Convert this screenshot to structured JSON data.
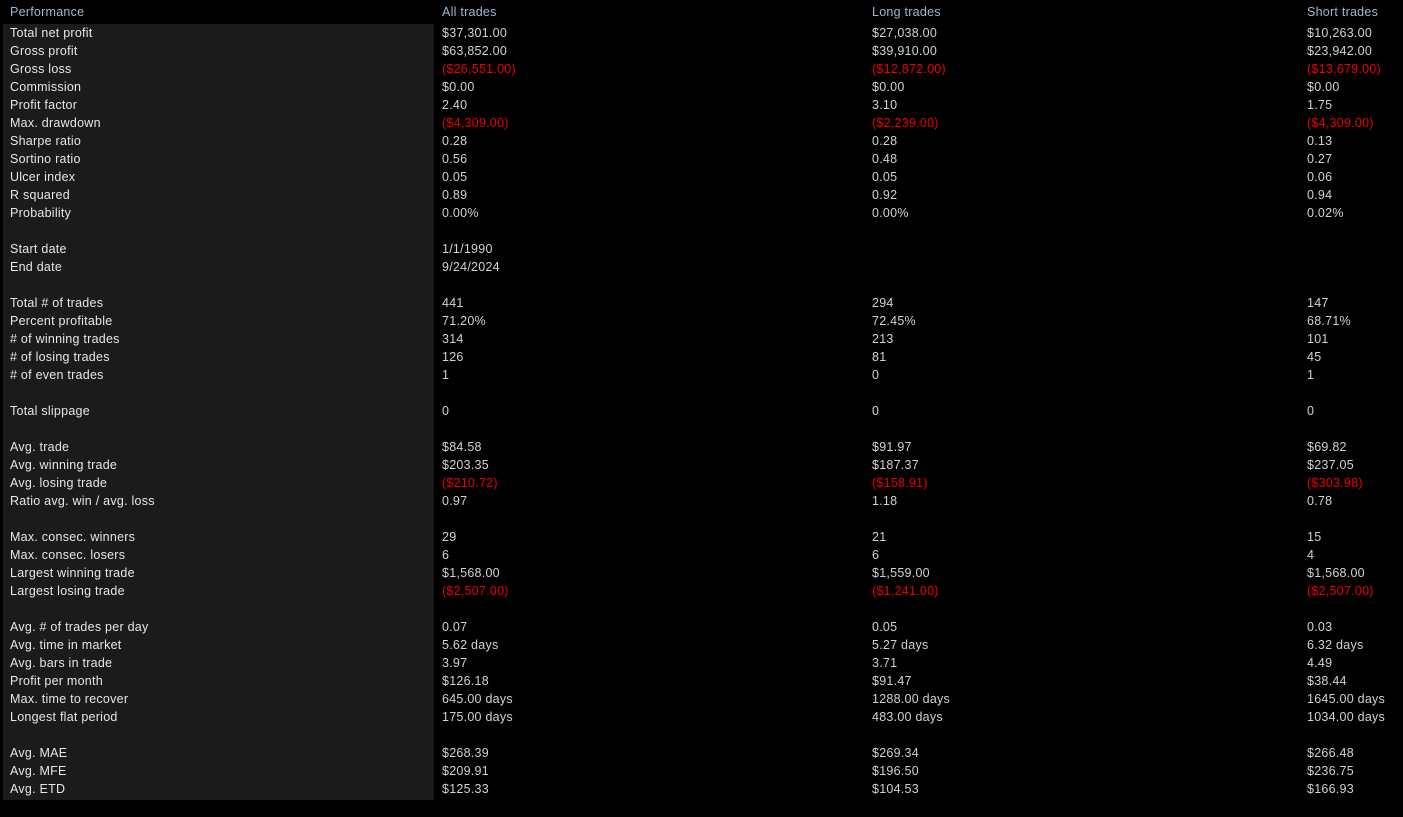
{
  "report": {
    "title": "Performance",
    "columns": [
      "Performance",
      "All trades",
      "Long trades",
      "Short trades"
    ],
    "colors": {
      "background": "#000000",
      "label_panel": "#1b1b1b",
      "header_text": "#9fb8d0",
      "label_text": "#e6e6e6",
      "value_text": "#d2d2d2",
      "negative_value": "#ef0000"
    },
    "rows": [
      {
        "label": "Total net profit",
        "all": "$37,301.00",
        "long": "$27,038.00",
        "short": "$10,263.00",
        "neg": false
      },
      {
        "label": "Gross profit",
        "all": "$63,852.00",
        "long": "$39,910.00",
        "short": "$23,942.00",
        "neg": false
      },
      {
        "label": "Gross loss",
        "all": "($26,551.00)",
        "long": "($12,872.00)",
        "short": "($13,679.00)",
        "neg": true
      },
      {
        "label": "Commission",
        "all": "$0.00",
        "long": "$0.00",
        "short": "$0.00",
        "neg": false
      },
      {
        "label": "Profit factor",
        "all": "2.40",
        "long": "3.10",
        "short": "1.75",
        "neg": false
      },
      {
        "label": "Max. drawdown",
        "all": "($4,309.00)",
        "long": "($2,239.00)",
        "short": "($4,309.00)",
        "neg": true
      },
      {
        "label": "Sharpe ratio",
        "all": "0.28",
        "long": "0.28",
        "short": "0.13",
        "neg": false
      },
      {
        "label": "Sortino ratio",
        "all": "0.56",
        "long": "0.48",
        "short": "0.27",
        "neg": false
      },
      {
        "label": "Ulcer index",
        "all": "0.05",
        "long": "0.05",
        "short": "0.06",
        "neg": false
      },
      {
        "label": "R squared",
        "all": "0.89",
        "long": "0.92",
        "short": "0.94",
        "neg": false
      },
      {
        "label": "Probability",
        "all": "0.00%",
        "long": "0.00%",
        "short": "0.02%",
        "neg": false
      },
      {
        "spacer": true
      },
      {
        "label": "Start date",
        "all": "1/1/1990",
        "long": "",
        "short": "",
        "neg": false
      },
      {
        "label": "End date",
        "all": "9/24/2024",
        "long": "",
        "short": "",
        "neg": false
      },
      {
        "spacer": true
      },
      {
        "label": "Total # of trades",
        "all": "441",
        "long": "294",
        "short": "147",
        "neg": false
      },
      {
        "label": "Percent profitable",
        "all": "71.20%",
        "long": "72.45%",
        "short": "68.71%",
        "neg": false
      },
      {
        "label": "# of winning trades",
        "all": "314",
        "long": "213",
        "short": "101",
        "neg": false
      },
      {
        "label": "# of losing trades",
        "all": "126",
        "long": "81",
        "short": "45",
        "neg": false
      },
      {
        "label": "# of even trades",
        "all": "1",
        "long": "0",
        "short": "1",
        "neg": false
      },
      {
        "spacer": true
      },
      {
        "label": "Total slippage",
        "all": "0",
        "long": "0",
        "short": "0",
        "neg": false
      },
      {
        "spacer": true
      },
      {
        "label": "Avg. trade",
        "all": "$84.58",
        "long": "$91.97",
        "short": "$69.82",
        "neg": false
      },
      {
        "label": "Avg. winning trade",
        "all": "$203.35",
        "long": "$187.37",
        "short": "$237.05",
        "neg": false
      },
      {
        "label": "Avg. losing trade",
        "all": "($210.72)",
        "long": "($158.91)",
        "short": "($303.98)",
        "neg": true
      },
      {
        "label": "Ratio avg. win / avg. loss",
        "all": "0.97",
        "long": "1.18",
        "short": "0.78",
        "neg": false
      },
      {
        "spacer": true
      },
      {
        "label": "Max. consec. winners",
        "all": "29",
        "long": "21",
        "short": "15",
        "neg": false
      },
      {
        "label": "Max. consec. losers",
        "all": "6",
        "long": "6",
        "short": "4",
        "neg": false
      },
      {
        "label": "Largest winning trade",
        "all": "$1,568.00",
        "long": "$1,559.00",
        "short": "$1,568.00",
        "neg": false
      },
      {
        "label": "Largest losing trade",
        "all": "($2,507.00)",
        "long": "($1,241.00)",
        "short": "($2,507.00)",
        "neg": true
      },
      {
        "spacer": true
      },
      {
        "label": "Avg. # of trades per day",
        "all": "0.07",
        "long": "0.05",
        "short": "0.03",
        "neg": false
      },
      {
        "label": "Avg. time in market",
        "all": "5.62 days",
        "long": "5.27 days",
        "short": "6.32 days",
        "neg": false
      },
      {
        "label": "Avg. bars in trade",
        "all": "3.97",
        "long": "3.71",
        "short": "4.49",
        "neg": false
      },
      {
        "label": "Profit per month",
        "all": "$126.18",
        "long": "$91.47",
        "short": "$38.44",
        "neg": false
      },
      {
        "label": "Max. time to recover",
        "all": "645.00 days",
        "long": "1288.00 days",
        "short": "1645.00 days",
        "neg": false
      },
      {
        "label": "Longest flat period",
        "all": "175.00 days",
        "long": "483.00 days",
        "short": "1034.00 days",
        "neg": false
      },
      {
        "spacer": true
      },
      {
        "label": "Avg. MAE",
        "all": "$268.39",
        "long": "$269.34",
        "short": "$266.48",
        "neg": false
      },
      {
        "label": "Avg. MFE",
        "all": "$209.91",
        "long": "$196.50",
        "short": "$236.75",
        "neg": false
      },
      {
        "label": "Avg. ETD",
        "all": "$125.33",
        "long": "$104.53",
        "short": "$166.93",
        "neg": false
      }
    ]
  }
}
